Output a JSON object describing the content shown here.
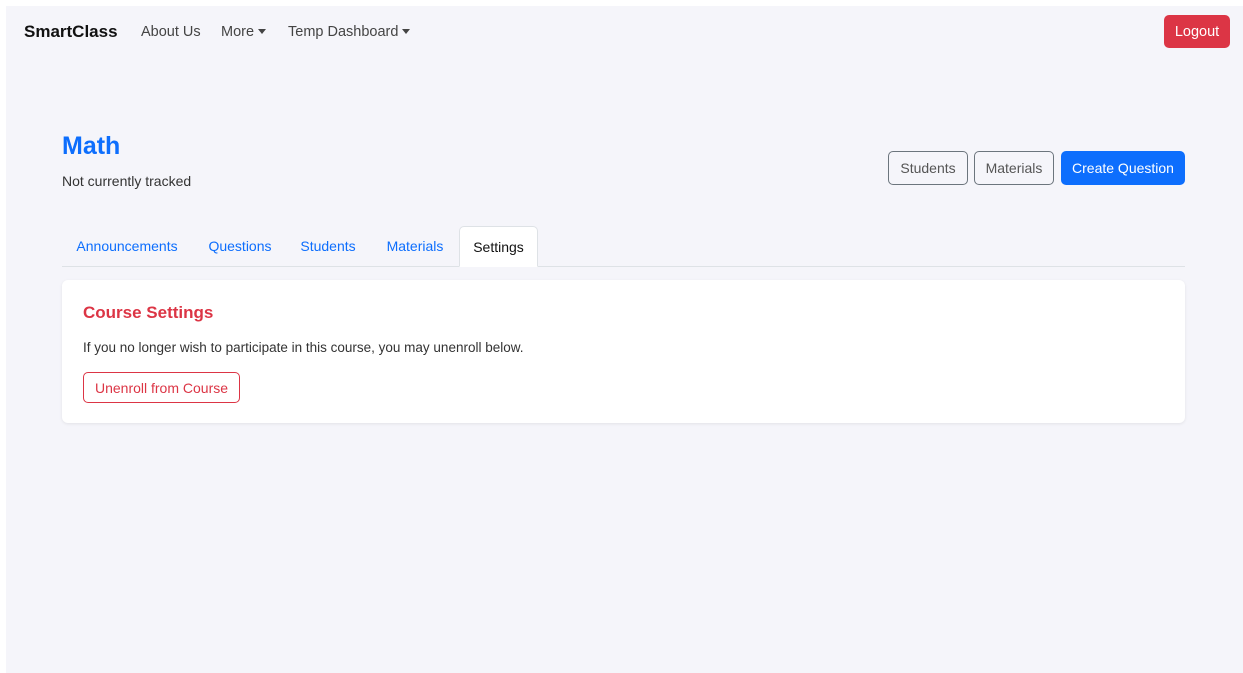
{
  "navbar": {
    "brand": "SmartClass",
    "links": [
      {
        "label": "About Us"
      },
      {
        "label": "More",
        "dropdown": true
      },
      {
        "label": "Temp Dashboard",
        "dropdown": true
      }
    ],
    "logout_label": "Logout"
  },
  "course": {
    "title": "Math",
    "subtitle": "Not currently tracked",
    "actions": {
      "students_label": "Students",
      "materials_label": "Materials",
      "create_question_label": "Create Question"
    }
  },
  "tabs": [
    {
      "label": "Announcements",
      "active": false
    },
    {
      "label": "Questions",
      "active": false
    },
    {
      "label": "Students",
      "active": false
    },
    {
      "label": "Materials",
      "active": false
    },
    {
      "label": "Settings",
      "active": true
    }
  ],
  "settings_card": {
    "title": "Course Settings",
    "description": "If you no longer wish to participate in this course, you may unenroll below.",
    "unenroll_label": "Unenroll from Course"
  },
  "colors": {
    "primary": "#0d6efd",
    "danger": "#dc3545",
    "background": "#f5f5fa"
  }
}
